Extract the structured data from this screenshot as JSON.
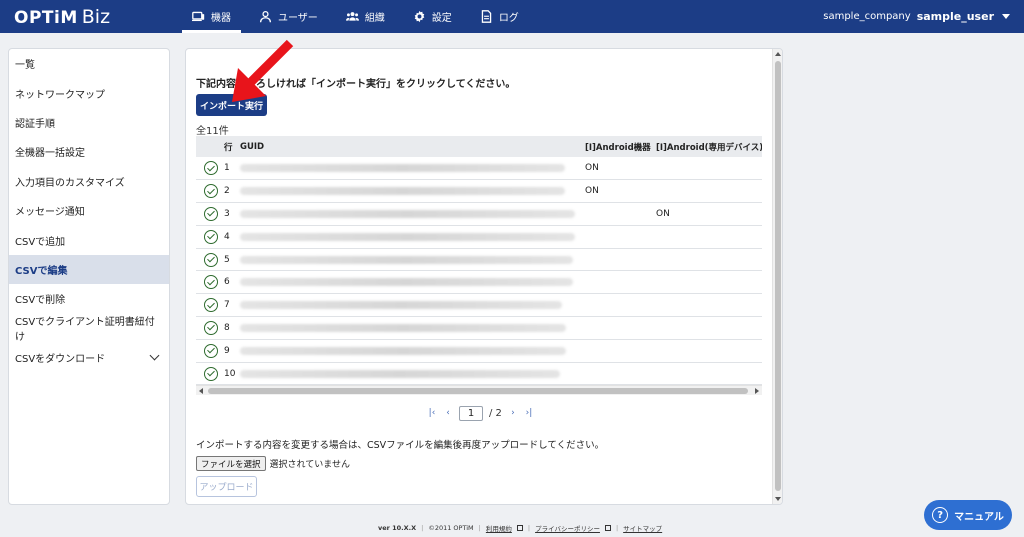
{
  "header": {
    "logo_main": "OPTiM",
    "logo_sub": "Biz",
    "nav": [
      {
        "label": "機器",
        "icon": "device-icon",
        "active": true
      },
      {
        "label": "ユーザー",
        "icon": "user-icon",
        "active": false
      },
      {
        "label": "組織",
        "icon": "group-icon",
        "active": false
      },
      {
        "label": "設定",
        "icon": "gear-icon",
        "active": false
      },
      {
        "label": "ログ",
        "icon": "log-icon",
        "active": false
      }
    ],
    "company": "sample_company",
    "user": "sample_user"
  },
  "sidebar": {
    "items": [
      {
        "label": "一覧"
      },
      {
        "label": "ネットワークマップ"
      },
      {
        "label": "認証手順"
      },
      {
        "label": "全機器一括設定"
      },
      {
        "label": "入力項目のカスタマイズ"
      },
      {
        "label": "メッセージ通知"
      },
      {
        "label": "CSVで追加"
      },
      {
        "label": "CSVで編集"
      },
      {
        "label": "CSVで削除"
      },
      {
        "label": "CSVでクライアント証明書紐付け"
      },
      {
        "label": "CSVをダウンロード"
      }
    ],
    "active_index": 7
  },
  "main": {
    "instruction": "下記内容でよろしければ「インポート実行」をクリックしてください。",
    "import_button": "インポート実行",
    "count_label": "全11件",
    "table": {
      "headers": [
        "",
        "行",
        "GUID",
        "[I]Android機器",
        "[I]Android(専用デバイス)"
      ],
      "rows": [
        {
          "row": "1",
          "android": "ON",
          "dedicated": ""
        },
        {
          "row": "2",
          "android": "ON",
          "dedicated": ""
        },
        {
          "row": "3",
          "android": "",
          "dedicated": "ON"
        },
        {
          "row": "4",
          "android": "",
          "dedicated": ""
        },
        {
          "row": "5",
          "android": "",
          "dedicated": ""
        },
        {
          "row": "6",
          "android": "",
          "dedicated": ""
        },
        {
          "row": "7",
          "android": "",
          "dedicated": ""
        },
        {
          "row": "8",
          "android": "",
          "dedicated": ""
        },
        {
          "row": "9",
          "android": "",
          "dedicated": ""
        },
        {
          "row": "10",
          "android": "",
          "dedicated": ""
        }
      ]
    },
    "pager": {
      "current": "1",
      "total_label": "/ 2"
    },
    "csv_note": "インポートする内容を変更する場合は、CSVファイルを編集後再度アップロードしてください。",
    "file_button": "ファイルを選択",
    "file_status": "選択されていません",
    "upload_button": "アップロード"
  },
  "footer": {
    "version": "ver 10.X.X",
    "copyright": "©2011 OPTiM",
    "terms": "利用規約",
    "privacy": "プライバシーポリシー",
    "sitemap": "サイトマップ"
  },
  "manual_button": "マニュアル",
  "colors": {
    "header_bg": "#1c3d86",
    "accent": "#1c3d86",
    "manual_bg": "#2e6fd2",
    "annotation": "#e8141b"
  }
}
